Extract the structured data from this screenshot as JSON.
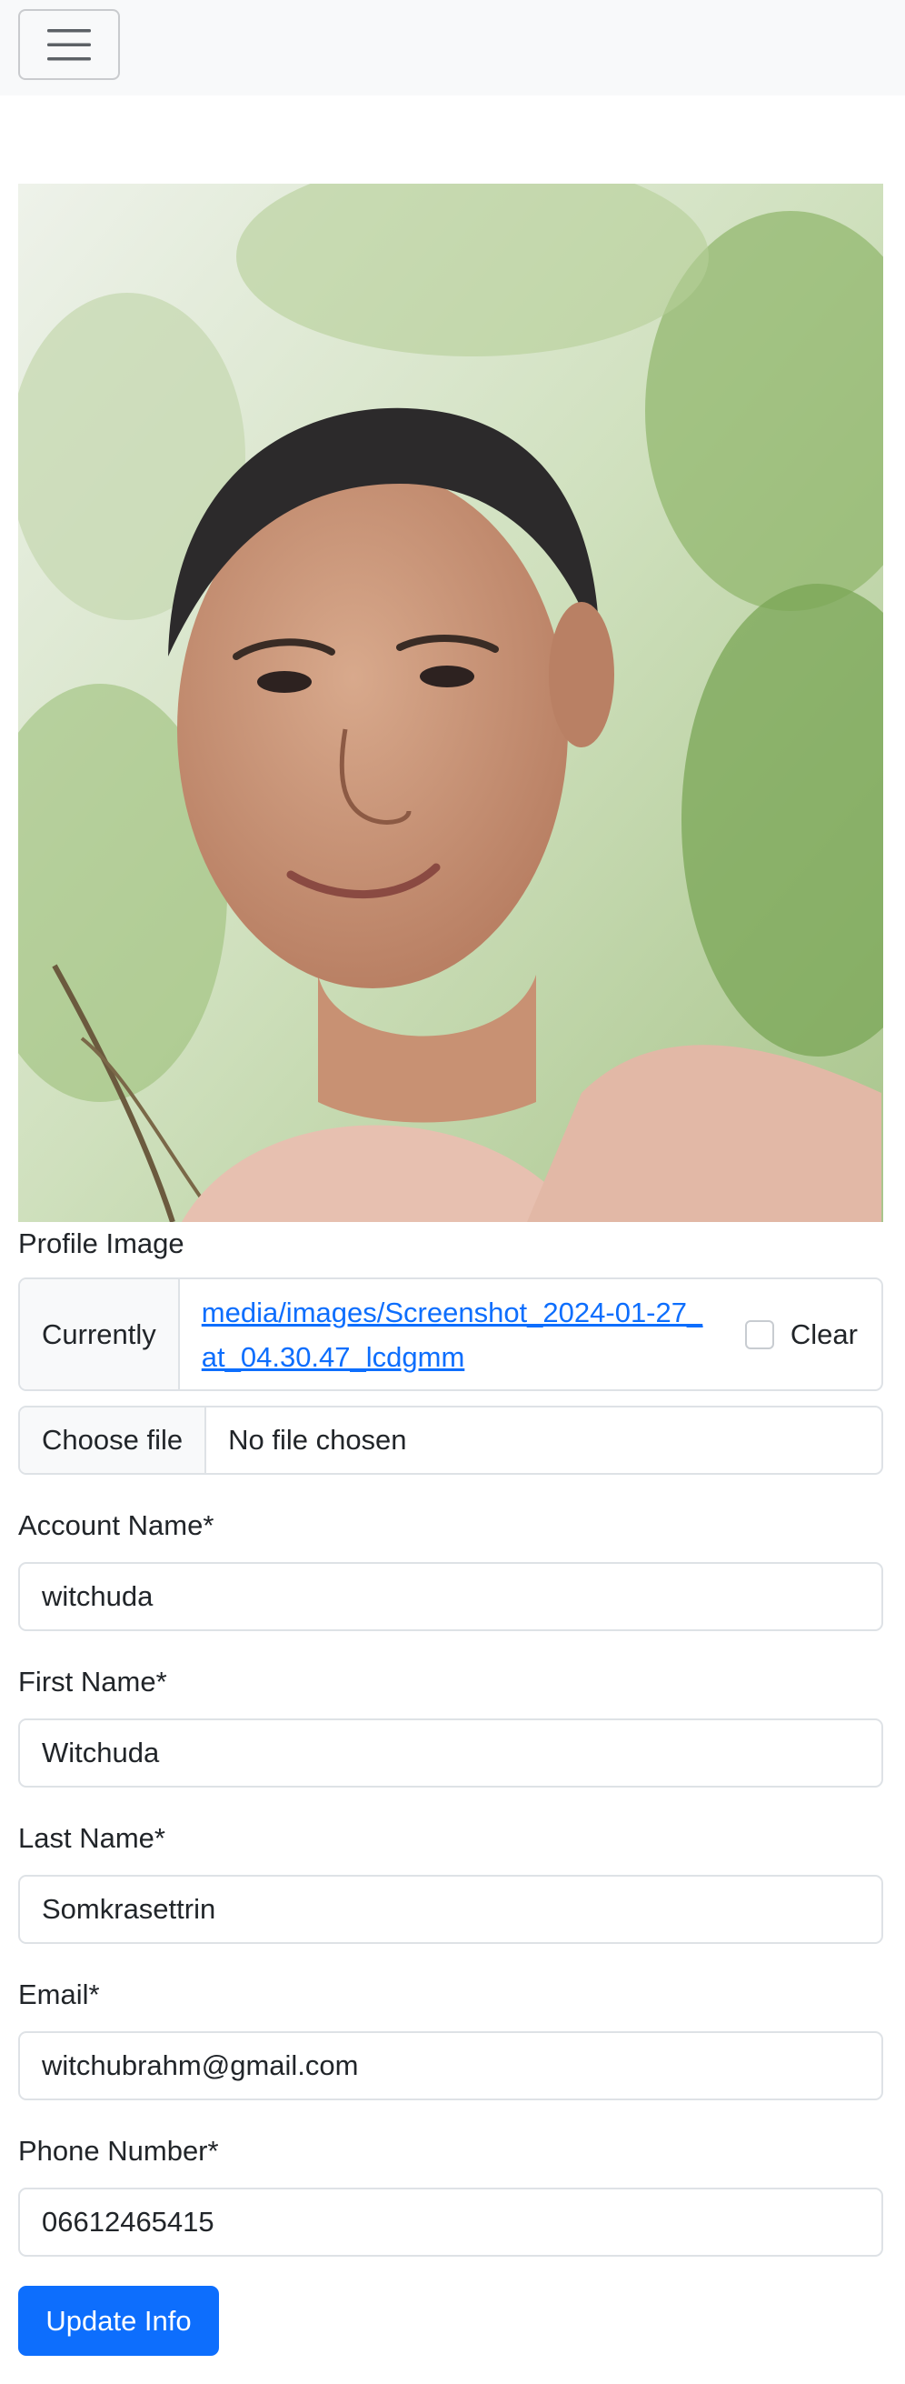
{
  "navbar": {
    "toggler_icon": "hamburger-menu-icon"
  },
  "profile": {
    "image_label": "Profile Image",
    "currently_label": "Currently",
    "current_file": "media/images/Screenshot_2024-01-27_at_04.30.47_lcdgmm",
    "clear_label": "Clear",
    "clear_checked": false,
    "choose_file_label": "Choose file",
    "file_status": "No file chosen"
  },
  "fields": {
    "account_name": {
      "label": "Account Name*",
      "value": "witchuda"
    },
    "first_name": {
      "label": "First Name*",
      "value": "Witchuda"
    },
    "last_name": {
      "label": "Last Name*",
      "value": "Somkrasettrin"
    },
    "email": {
      "label": "Email*",
      "value": "witchubrahm@gmail.com"
    },
    "phone": {
      "label": "Phone Number*",
      "value": "06612465415"
    }
  },
  "submit_label": "Update Info",
  "colors": {
    "primary": "#0d6efd",
    "navbar_bg": "#f8f9fa",
    "border": "#dee2e6"
  }
}
